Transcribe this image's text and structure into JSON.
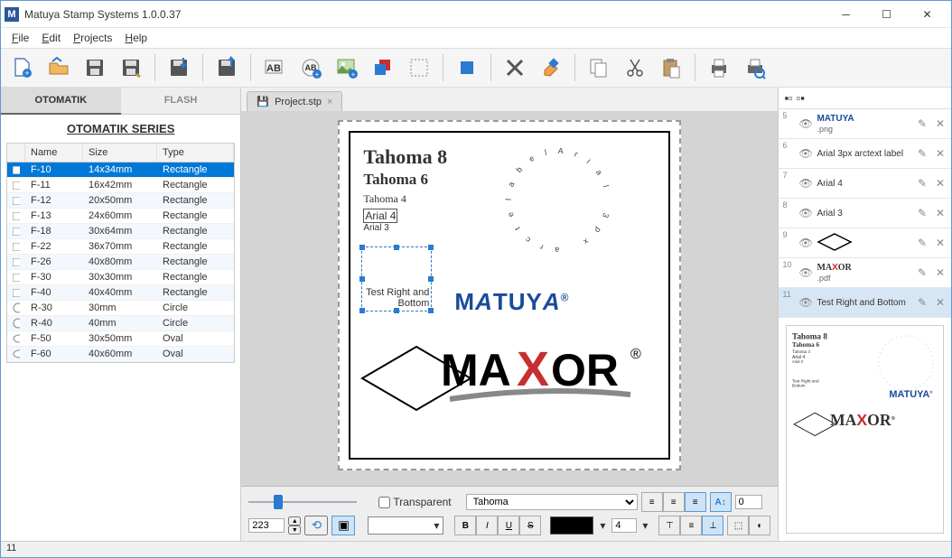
{
  "window": {
    "title": "Matuya Stamp Systems 1.0.0.37",
    "app_icon": "M"
  },
  "menu": {
    "file": "File",
    "edit": "Edit",
    "projects": "Projects",
    "help": "Help"
  },
  "left": {
    "tab1": "OTOMATIK",
    "tab2": "FLASH",
    "series_title": "OTOMATIK SERIES",
    "columns": {
      "name": "Name",
      "size": "Size",
      "type": "Type"
    },
    "rows": [
      {
        "name": "F-10",
        "size": "14x34mm",
        "type": "Rectangle",
        "shape": "rect",
        "selected": true
      },
      {
        "name": "F-11",
        "size": "16x42mm",
        "type": "Rectangle",
        "shape": "rect"
      },
      {
        "name": "F-12",
        "size": "20x50mm",
        "type": "Rectangle",
        "shape": "rect"
      },
      {
        "name": "F-13",
        "size": "24x60mm",
        "type": "Rectangle",
        "shape": "rect"
      },
      {
        "name": "F-18",
        "size": "30x64mm",
        "type": "Rectangle",
        "shape": "rect"
      },
      {
        "name": "F-22",
        "size": "36x70mm",
        "type": "Rectangle",
        "shape": "rect"
      },
      {
        "name": "F-26",
        "size": "40x80mm",
        "type": "Rectangle",
        "shape": "rect"
      },
      {
        "name": "F-30",
        "size": "30x30mm",
        "type": "Rectangle",
        "shape": "rect"
      },
      {
        "name": "F-40",
        "size": "40x40mm",
        "type": "Rectangle",
        "shape": "rect"
      },
      {
        "name": "R-30",
        "size": "30mm",
        "type": "Circle",
        "shape": "circle"
      },
      {
        "name": "R-40",
        "size": "40mm",
        "type": "Circle",
        "shape": "circle"
      },
      {
        "name": "F-50",
        "size": "30x50mm",
        "type": "Oval",
        "shape": "oval"
      },
      {
        "name": "F-60",
        "size": "40x60mm",
        "type": "Oval",
        "shape": "oval"
      }
    ]
  },
  "doc_tab": {
    "label": "Project.stp"
  },
  "canvas": {
    "t1": "Tahoma 8",
    "t2": "Tahoma 6",
    "t3": "Tahoma 4",
    "t4": "Arial 4",
    "t5": "Arial 3",
    "sel_label": "Test Right and Bottom",
    "arc_text": "Arial 3px arctext label",
    "brand1": "MATUYA",
    "brand2": "MAXOR"
  },
  "layers": [
    {
      "n": "5",
      "label": ".png",
      "preview": "matuya"
    },
    {
      "n": "6",
      "label": "Arial 3px arctext label",
      "preview": "text"
    },
    {
      "n": "7",
      "label": "Arial 4",
      "preview": "text"
    },
    {
      "n": "8",
      "label": "Arial 3",
      "preview": "text"
    },
    {
      "n": "9",
      "label": "",
      "preview": "diamond"
    },
    {
      "n": "10",
      "label": ".pdf",
      "preview": "maxor"
    },
    {
      "n": "11",
      "label": "Test Right and Bottom",
      "preview": "text",
      "selected": true
    }
  ],
  "bottom": {
    "transparent": "Transparent",
    "font": "Tahoma",
    "width": "223",
    "fontsize": "4"
  },
  "status": "11"
}
